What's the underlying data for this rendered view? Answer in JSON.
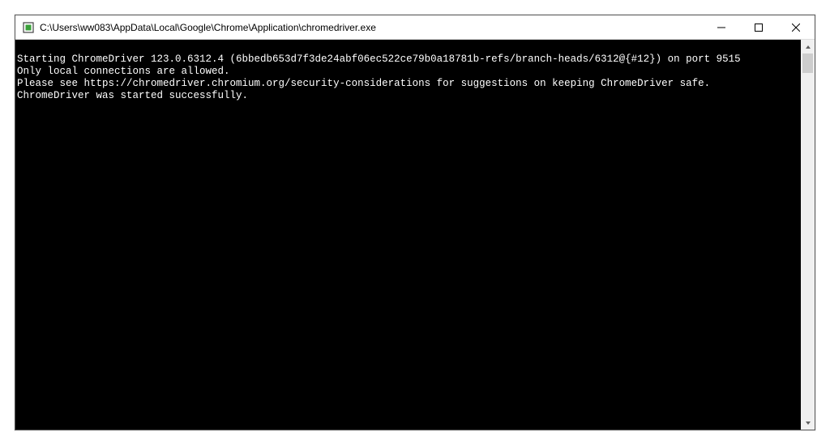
{
  "window": {
    "title": "C:\\Users\\ww083\\AppData\\Local\\Google\\Chrome\\Application\\chromedriver.exe"
  },
  "console": {
    "lines": [
      "Starting ChromeDriver 123.0.6312.4 (6bbedb653d7f3de24abf06ec522ce79b0a18781b-refs/branch-heads/6312@{#12}) on port 9515",
      "Only local connections are allowed.",
      "Please see https://chromedriver.chromium.org/security-considerations for suggestions on keeping ChromeDriver safe.",
      "ChromeDriver was started successfully."
    ]
  }
}
